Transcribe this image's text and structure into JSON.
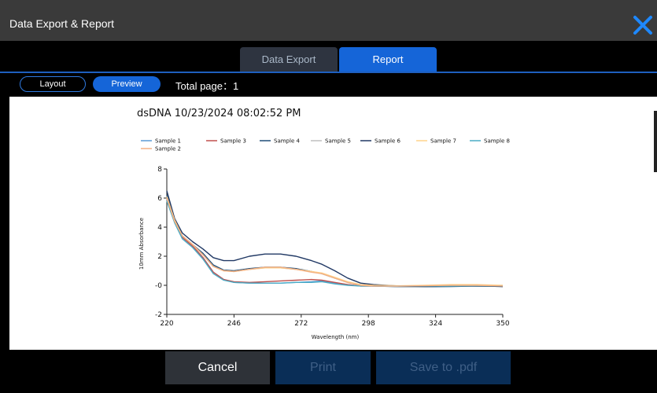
{
  "window": {
    "title": "Data Export & Report",
    "close_icon": "close-icon"
  },
  "tabs": [
    {
      "label": "Data Export",
      "active": false
    },
    {
      "label": "Report",
      "active": true
    }
  ],
  "viewbar": {
    "layout_label": "Layout",
    "preview_label": "Preview",
    "total_page": "Total page：1"
  },
  "footer": {
    "cancel_label": "Cancel",
    "print_label": "Print",
    "save_label": "Save to .pdf"
  },
  "colors": {
    "accent": "#1565d8",
    "titlebar": "#3a3a3a",
    "close": "#1e88ff"
  },
  "chart_data": {
    "type": "line",
    "title": "dsDNA 10/23/2024 08:02:52 PM",
    "xlabel": "Wavelength (nm)",
    "ylabel": "10mm Absorbance",
    "xlim": [
      220,
      350
    ],
    "ylim": [
      -2,
      8
    ],
    "xticks": [
      "220",
      "246",
      "272",
      "298",
      "324",
      "350"
    ],
    "yticks": [
      "-2",
      "-0",
      "2",
      "4",
      "6",
      "8"
    ],
    "legend_position": "top-left",
    "series": [
      {
        "name": "Sample 1",
        "color": "#5b9bd5",
        "x": [
          220,
          223,
          226,
          230,
          234,
          238,
          242,
          246,
          252,
          258,
          264,
          270,
          276,
          280,
          285,
          290,
          295,
          300,
          310,
          320,
          330,
          340,
          350
        ],
        "y": [
          5.9,
          4.4,
          3.3,
          2.7,
          1.9,
          0.9,
          0.4,
          0.2,
          0.15,
          0.15,
          0.15,
          0.2,
          0.25,
          0.3,
          0.15,
          0.05,
          -0.05,
          -0.05,
          -0.05,
          -0.05,
          -0.03,
          -0.03,
          -0.05
        ]
      },
      {
        "name": "Sample 3",
        "color": "#c0504d",
        "x": [
          220,
          223,
          226,
          230,
          234,
          238,
          242,
          246,
          252,
          258,
          264,
          270,
          276,
          280,
          285,
          290,
          295,
          300,
          310,
          320,
          330,
          340,
          350
        ],
        "y": [
          6.0,
          4.4,
          3.3,
          2.7,
          1.9,
          0.9,
          0.4,
          0.25,
          0.2,
          0.25,
          0.3,
          0.35,
          0.4,
          0.35,
          0.2,
          0.05,
          -0.05,
          -0.05,
          -0.05,
          -0.03,
          0.0,
          -0.03,
          -0.05
        ]
      },
      {
        "name": "Sample 4",
        "color": "#1f4e79",
        "x": [
          220,
          223,
          226,
          230,
          234,
          238,
          242,
          246,
          252,
          258,
          264,
          270,
          276,
          280,
          285,
          290,
          295,
          300,
          310,
          320,
          330,
          340,
          350
        ],
        "y": [
          6.2,
          4.5,
          3.4,
          2.8,
          2.2,
          1.4,
          1.05,
          1.0,
          1.15,
          1.25,
          1.25,
          1.15,
          0.95,
          0.8,
          0.5,
          0.2,
          0.0,
          -0.05,
          -0.1,
          -0.1,
          -0.08,
          -0.05,
          -0.08
        ]
      },
      {
        "name": "Sample 5",
        "color": "#bfbfbf",
        "x": [
          220,
          223,
          226,
          230,
          234,
          238,
          242,
          246,
          252,
          258,
          264,
          270,
          276,
          280,
          285,
          290,
          295,
          300,
          310,
          320,
          330,
          340,
          350
        ],
        "y": [
          6.0,
          4.4,
          3.4,
          2.8,
          2.1,
          1.3,
          1.0,
          0.95,
          1.1,
          1.2,
          1.2,
          1.1,
          0.95,
          0.8,
          0.5,
          0.2,
          0.0,
          -0.05,
          -0.08,
          -0.08,
          -0.05,
          -0.05,
          -0.08
        ]
      },
      {
        "name": "Sample 6",
        "color": "#203864",
        "x": [
          220,
          223,
          226,
          230,
          234,
          238,
          242,
          246,
          252,
          258,
          264,
          270,
          276,
          280,
          285,
          290,
          295,
          300,
          310,
          320,
          330,
          340,
          350
        ],
        "y": [
          6.5,
          4.6,
          3.6,
          3.0,
          2.5,
          1.9,
          1.7,
          1.7,
          2.0,
          2.15,
          2.15,
          2.0,
          1.7,
          1.45,
          1.0,
          0.5,
          0.15,
          0.05,
          -0.05,
          -0.08,
          -0.05,
          -0.05,
          -0.08
        ]
      },
      {
        "name": "Sample 7",
        "color": "#ffd28a",
        "x": [
          220,
          223,
          226,
          230,
          234,
          238,
          242,
          246,
          252,
          258,
          264,
          270,
          276,
          280,
          285,
          290,
          295,
          300,
          310,
          320,
          330,
          340,
          350
        ],
        "y": [
          6.1,
          4.5,
          3.4,
          2.8,
          2.1,
          1.3,
          1.0,
          0.95,
          1.1,
          1.2,
          1.2,
          1.1,
          0.95,
          0.85,
          0.55,
          0.25,
          0.05,
          0.0,
          -0.03,
          0.0,
          0.05,
          0.05,
          0.0
        ]
      },
      {
        "name": "Sample 8",
        "color": "#4bacc6",
        "x": [
          220,
          223,
          226,
          230,
          234,
          238,
          242,
          246,
          252,
          258,
          264,
          270,
          276,
          280,
          285,
          290,
          295,
          300,
          310,
          320,
          330,
          340,
          350
        ],
        "y": [
          5.8,
          4.3,
          3.2,
          2.6,
          1.8,
          0.8,
          0.35,
          0.2,
          0.15,
          0.15,
          0.15,
          0.2,
          0.2,
          0.25,
          0.1,
          0.0,
          -0.05,
          -0.05,
          -0.05,
          -0.05,
          -0.05,
          -0.03,
          -0.05
        ]
      },
      {
        "name": "Sample 2",
        "color": "#f4b183",
        "x": [
          220,
          223,
          226,
          230,
          234,
          238,
          242,
          246,
          252,
          258,
          264,
          270,
          276,
          280,
          285,
          290,
          295,
          300,
          310,
          320,
          330,
          340,
          350
        ],
        "y": [
          6.0,
          4.4,
          3.4,
          2.8,
          2.1,
          1.3,
          1.0,
          0.95,
          1.1,
          1.25,
          1.25,
          1.1,
          0.9,
          0.8,
          0.5,
          0.2,
          0.0,
          -0.05,
          -0.05,
          -0.03,
          0.0,
          0.0,
          -0.05
        ]
      }
    ]
  }
}
